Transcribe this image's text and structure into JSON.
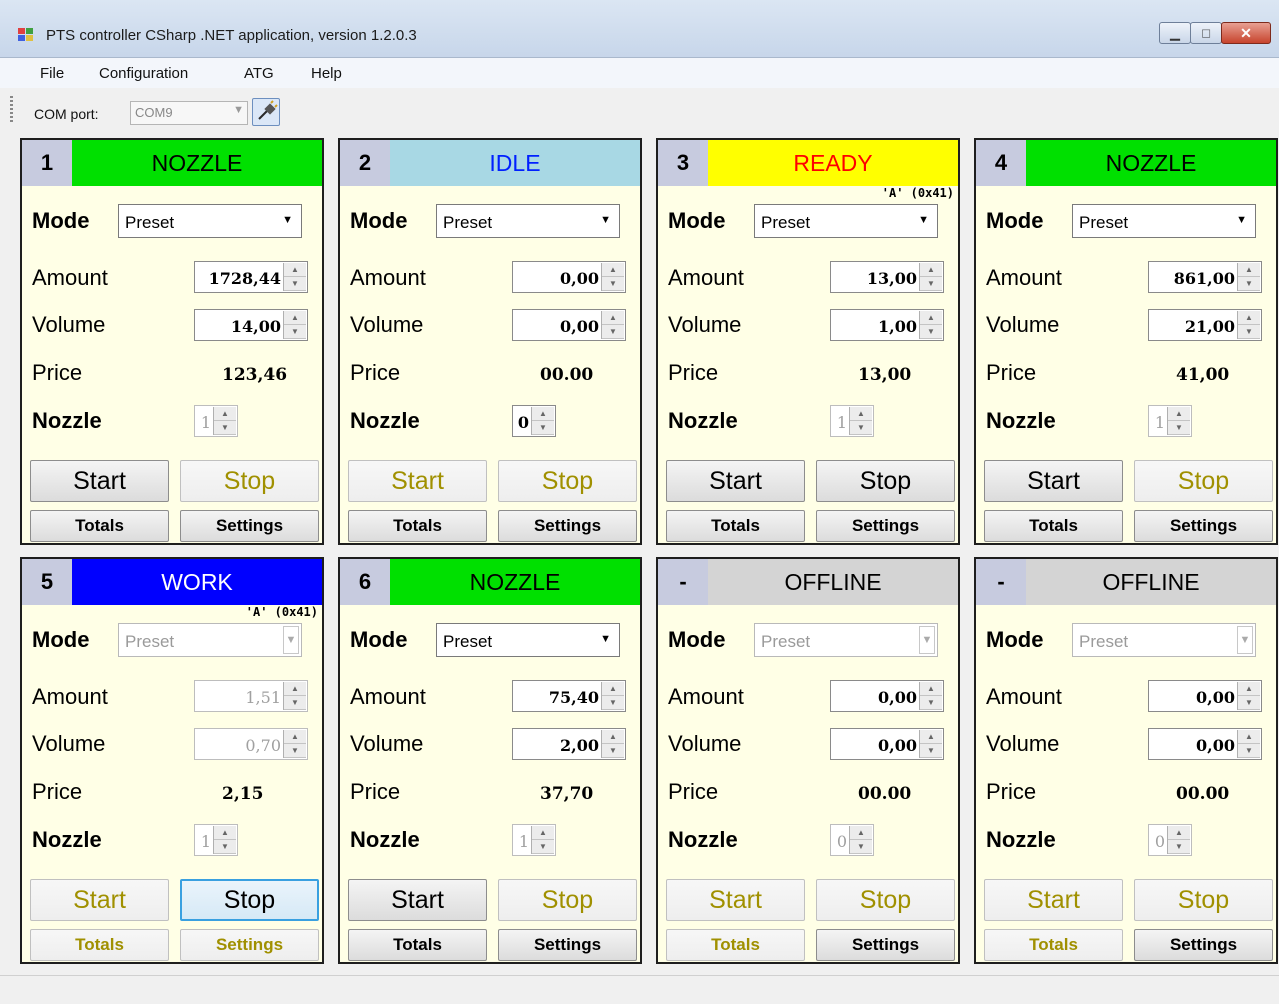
{
  "window": {
    "title": "PTS controller CSharp .NET application, version 1.2.0.3"
  },
  "menu": [
    "File",
    "Configuration",
    "ATG",
    "Help"
  ],
  "toolbar": {
    "com_label": "COM port:",
    "com_value": "COM9"
  },
  "labels": {
    "mode": "Mode",
    "amount": "Amount",
    "volume": "Volume",
    "price": "Price",
    "nozzle": "Nozzle",
    "start": "Start",
    "stop": "Stop",
    "totals": "Totals",
    "settings": "Settings"
  },
  "colors": {
    "nozzle": "#00e000",
    "idle": "#a8d8e4",
    "ready": "#ffff00",
    "work": "#0000ff",
    "offline": "#d4d4d4"
  },
  "pumps": [
    {
      "num": "1",
      "state": "NOZZLE",
      "badge": "",
      "mode": "Preset",
      "amount": "1728,44",
      "volume": "14,00",
      "price": "123,46",
      "nozzle": "1"
    },
    {
      "num": "2",
      "state": "IDLE",
      "badge": "",
      "mode": "Preset",
      "amount": "0,00",
      "volume": "0,00",
      "price": "00.00",
      "nozzle": "0"
    },
    {
      "num": "3",
      "state": "READY",
      "badge": "'A' (0x41)",
      "mode": "Preset",
      "amount": "13,00",
      "volume": "1,00",
      "price": "13,00",
      "nozzle": "1"
    },
    {
      "num": "4",
      "state": "NOZZLE",
      "badge": "",
      "mode": "Preset",
      "amount": "861,00",
      "volume": "21,00",
      "price": "41,00",
      "nozzle": "1"
    },
    {
      "num": "5",
      "state": "WORK",
      "badge": "'A' (0x41)",
      "mode": "Preset",
      "amount": "1,51",
      "volume": "0,70",
      "price": "2,15",
      "nozzle": "1"
    },
    {
      "num": "6",
      "state": "NOZZLE",
      "badge": "",
      "mode": "Preset",
      "amount": "75,40",
      "volume": "2,00",
      "price": "37,70",
      "nozzle": "1"
    },
    {
      "num": "-",
      "state": "OFFLINE",
      "badge": "",
      "mode": "Preset",
      "amount": "0,00",
      "volume": "0,00",
      "price": "00.00",
      "nozzle": "0"
    },
    {
      "num": "-",
      "state": "OFFLINE",
      "badge": "",
      "mode": "Preset",
      "amount": "0,00",
      "volume": "0,00",
      "price": "00.00",
      "nozzle": "0"
    }
  ]
}
